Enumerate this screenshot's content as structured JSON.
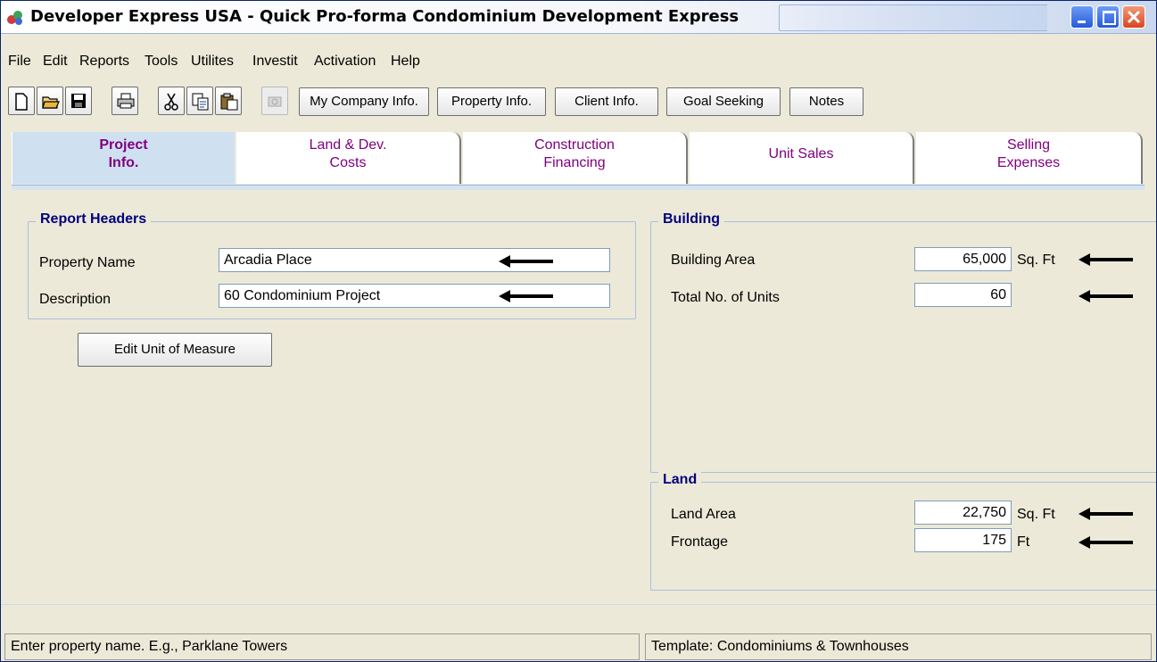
{
  "window": {
    "title": "Developer Express  USA - Quick Pro-forma Condominium Development Express"
  },
  "menu": {
    "items": [
      {
        "label": "File"
      },
      {
        "label": "Edit"
      },
      {
        "label": "Reports"
      },
      {
        "label": "Tools"
      },
      {
        "label": "Utilites"
      },
      {
        "label": "Investit"
      },
      {
        "label": "Activation"
      },
      {
        "label": "Help"
      }
    ]
  },
  "toolbar": {
    "icons": [
      "new-file-icon",
      "open-folder-icon",
      "save-disk-icon",
      "print-icon",
      "cut-scissors-icon",
      "copy-icon",
      "paste-icon",
      "camera-icon"
    ],
    "buttons": [
      {
        "label": "My Company Info."
      },
      {
        "label": "Property Info."
      },
      {
        "label": "Client Info."
      },
      {
        "label": "Goal Seeking"
      },
      {
        "label": "Notes"
      }
    ]
  },
  "tabs": [
    {
      "line1": "Project",
      "line2": "Info.",
      "active": true
    },
    {
      "line1": "Land & Dev.",
      "line2": "Costs"
    },
    {
      "line1": "Construction",
      "line2": "Financing"
    },
    {
      "line1": "Unit Sales",
      "line2": ""
    },
    {
      "line1": "Selling",
      "line2": "Expenses"
    }
  ],
  "report_headers": {
    "title": "Report Headers",
    "property_name_label": "Property Name",
    "property_name_value": "Arcadia Place",
    "description_label": "Description",
    "description_value": "60 Condominium Project"
  },
  "edit_unit_button": "Edit Unit of Measure",
  "building": {
    "title": "Building",
    "area_label": "Building Area",
    "area_value": "65,000",
    "area_unit": "Sq. Ft",
    "units_label": "Total No. of Units",
    "units_value": "60"
  },
  "land": {
    "title": "Land",
    "area_label": "Land Area",
    "area_value": "22,750",
    "area_unit": "Sq. Ft",
    "frontage_label": "Frontage",
    "frontage_value": "175",
    "frontage_unit": "Ft"
  },
  "status": {
    "left": "Enter property name. E.g., Parklane Towers",
    "right": "Template: Condominiums & Townhouses"
  },
  "colors": {
    "tab_text": "#800080",
    "group_title": "#00007e",
    "active_tab_bg": "#cfe0f0"
  }
}
